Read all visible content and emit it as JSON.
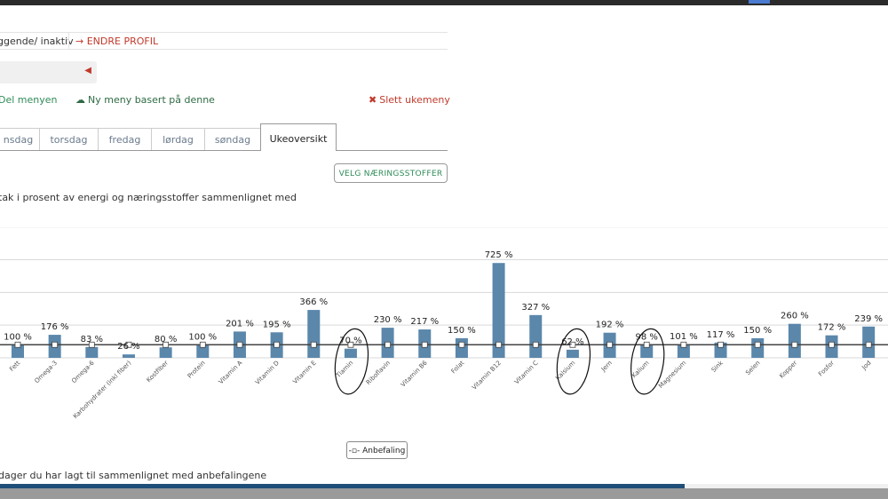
{
  "profile": {
    "status": "ggende/ inaktiv",
    "edit_link": "→ ENDRE PROFIL"
  },
  "actions": {
    "share": "Del menyen",
    "new_menu": "Ny meny basert på denne",
    "delete": "Slett ukemeny"
  },
  "tabs": [
    "nsdag",
    "torsdag",
    "fredag",
    "lørdag",
    "søndag",
    "Ukeoversikt"
  ],
  "active_tab": "Ukeoversikt",
  "select_button": "VELG NÆRINGSSTOFFER",
  "description": "tak i prosent av energi og næringsstoffer sammenlignet med",
  "footer_text": " dager du har lagt til sammenlignet med anbefalingene",
  "legend_label": "Anbefaling",
  "colors": {
    "bar": "#5b87ab",
    "recommendation_line": "#444444",
    "grid": "#d9d9d9",
    "accent_red": "#c0392b",
    "accent_green": "#2e8b57",
    "bottom_bar": "#1f4e79"
  },
  "chart_data": {
    "type": "bar",
    "categories": [
      "Fett",
      "Omega-3",
      "Omega-6",
      "Karbohydrater (inkl fiber)",
      "Kostfiber",
      "Protein",
      "Vitamin A",
      "Vitamin D",
      "Vitamin E",
      "Tiamin",
      "Riboflavin",
      "Vitamin B6",
      "Folat",
      "Vitamin B12",
      "Vitamin C",
      "Kalsium",
      "Jern",
      "Kalium",
      "Magnesium",
      "Sink",
      "Selen",
      "Kopper",
      "Fosfor",
      "Jod"
    ],
    "values": [
      100,
      176,
      83,
      26,
      80,
      100,
      201,
      195,
      366,
      70,
      230,
      217,
      150,
      725,
      327,
      62,
      192,
      98,
      101,
      117,
      150,
      260,
      172,
      239
    ],
    "value_labels": [
      "100 %",
      "176 %",
      "83 %",
      "26 %",
      "80 %",
      "100 %",
      "201 %",
      "195 %",
      "366 %",
      "70 %",
      "230 %",
      "217 %",
      "150 %",
      "725 %",
      "327 %",
      "62 %",
      "192 %",
      "98 %",
      "101 %",
      "117 %",
      "150 %",
      "260 %",
      "172 %",
      "239 %"
    ],
    "recommendation": 100,
    "ylim": [
      -100,
      900
    ],
    "grid": true,
    "legend": "bottom-center",
    "highlighted": [
      "Tiamin",
      "Kalsium",
      "Kalium"
    ]
  }
}
